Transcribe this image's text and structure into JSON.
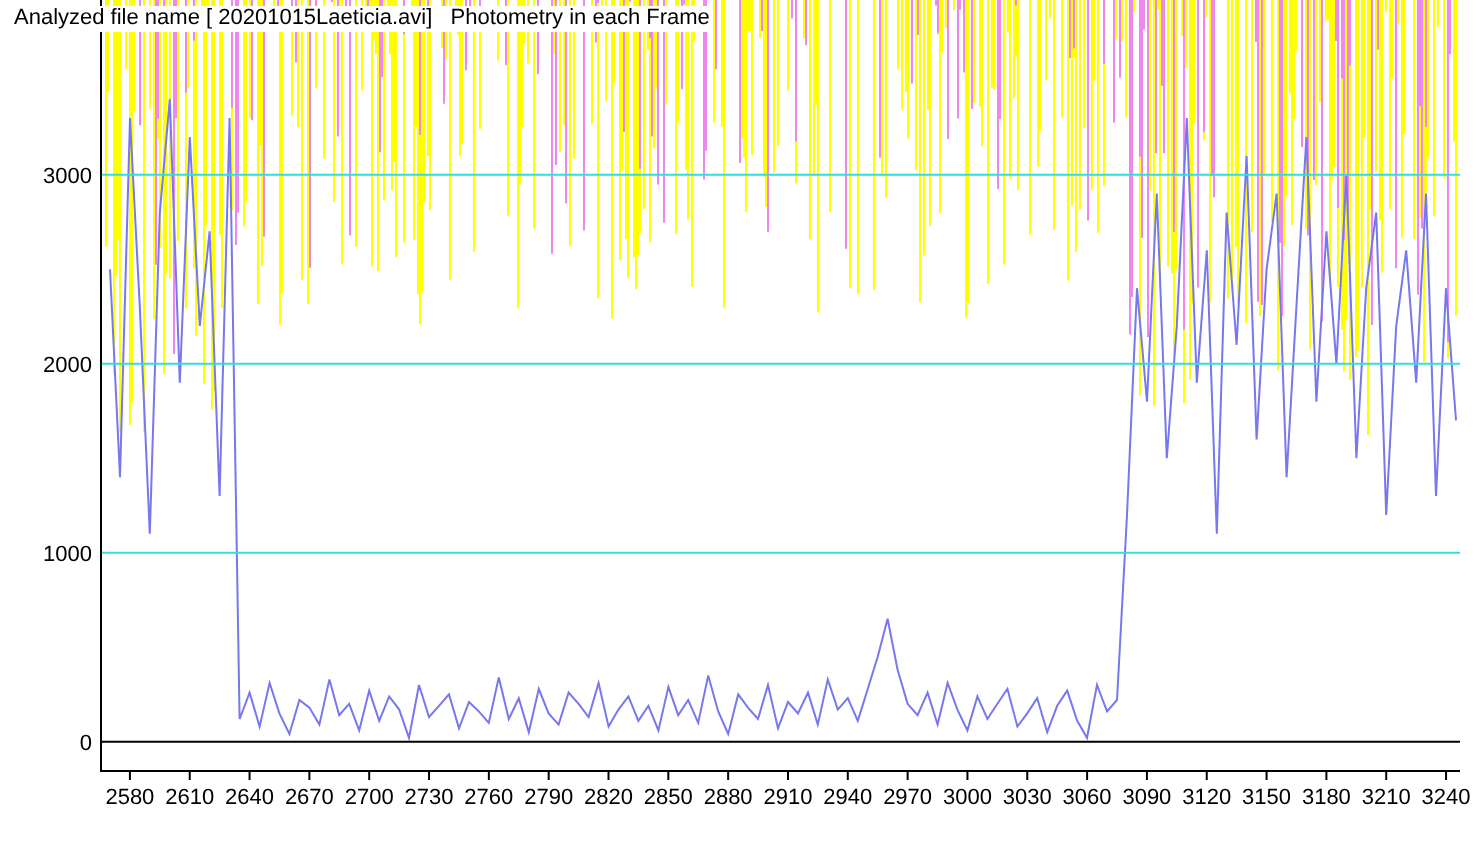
{
  "chart_data": {
    "type": "line",
    "title": "Analyzed file name [ 20201015Laeticia.avi]   Photometry in each Frame",
    "x": [
      2570,
      2575,
      2580,
      2585,
      2590,
      2595,
      2600,
      2605,
      2610,
      2615,
      2620,
      2625,
      2630,
      2635,
      2640,
      2645,
      2650,
      2655,
      2660,
      2665,
      2670,
      2675,
      2680,
      2685,
      2690,
      2695,
      2700,
      2705,
      2710,
      2715,
      2720,
      2725,
      2730,
      2735,
      2740,
      2745,
      2750,
      2755,
      2760,
      2765,
      2770,
      2775,
      2780,
      2785,
      2790,
      2795,
      2800,
      2805,
      2810,
      2815,
      2820,
      2825,
      2830,
      2835,
      2840,
      2845,
      2850,
      2855,
      2860,
      2865,
      2870,
      2875,
      2880,
      2885,
      2890,
      2895,
      2900,
      2905,
      2910,
      2915,
      2920,
      2925,
      2930,
      2935,
      2940,
      2945,
      2950,
      2955,
      2960,
      2965,
      2970,
      2975,
      2980,
      2985,
      2990,
      2995,
      3000,
      3005,
      3010,
      3015,
      3020,
      3025,
      3030,
      3035,
      3040,
      3045,
      3050,
      3055,
      3060,
      3065,
      3070,
      3075,
      3080,
      3085,
      3090,
      3095,
      3100,
      3105,
      3110,
      3115,
      3120,
      3125,
      3130,
      3135,
      3140,
      3145,
      3150,
      3155,
      3160,
      3165,
      3170,
      3175,
      3180,
      3185,
      3190,
      3195,
      3200,
      3205,
      3210,
      3215,
      3220,
      3225,
      3230,
      3235,
      3240,
      3245
    ],
    "series": [
      {
        "color": "#7777ee",
        "values": [
          2500,
          1400,
          3300,
          2300,
          1100,
          2800,
          3400,
          1900,
          3200,
          2200,
          2700,
          1300,
          3300,
          120,
          260,
          80,
          310,
          150,
          40,
          220,
          180,
          90,
          330,
          140,
          200,
          60,
          270,
          110,
          240,
          170,
          20,
          300,
          130,
          190,
          250,
          70,
          210,
          160,
          100,
          340,
          120,
          230,
          50,
          280,
          150,
          90,
          260,
          200,
          130,
          310,
          80,
          170,
          240,
          110,
          190,
          60,
          290,
          140,
          220,
          100,
          350,
          160,
          40,
          250,
          180,
          120,
          300,
          70,
          210,
          150,
          260,
          90,
          330,
          170,
          230,
          110,
          280,
          450,
          650,
          380,
          200,
          140,
          260,
          90,
          310,
          170,
          60,
          240,
          120,
          200,
          280,
          80,
          150,
          230,
          50,
          190,
          270,
          110,
          20,
          300,
          160,
          220,
          1200,
          2400,
          1800,
          2900,
          1500,
          2200,
          3300,
          1900,
          2600,
          1100,
          2800,
          2100,
          3100,
          1600,
          2500,
          2900,
          1400,
          2300,
          3200,
          1800,
          2700,
          2000,
          3000,
          1500,
          2400,
          2800,
          1200,
          2200,
          2600,
          1900,
          2900,
          1300,
          2400,
          1700
        ]
      }
    ],
    "xlim": [
      2565,
      3247
    ],
    "ylim": [
      -150,
      3925
    ],
    "xticks": [
      2580,
      2610,
      2640,
      2670,
      2700,
      2730,
      2760,
      2790,
      2820,
      2850,
      2880,
      2910,
      2940,
      2970,
      3000,
      3030,
      3060,
      3090,
      3120,
      3150,
      3180,
      3210,
      3240
    ],
    "yticks": [
      3000,
      2000,
      1000,
      0
    ],
    "grid": true
  }
}
